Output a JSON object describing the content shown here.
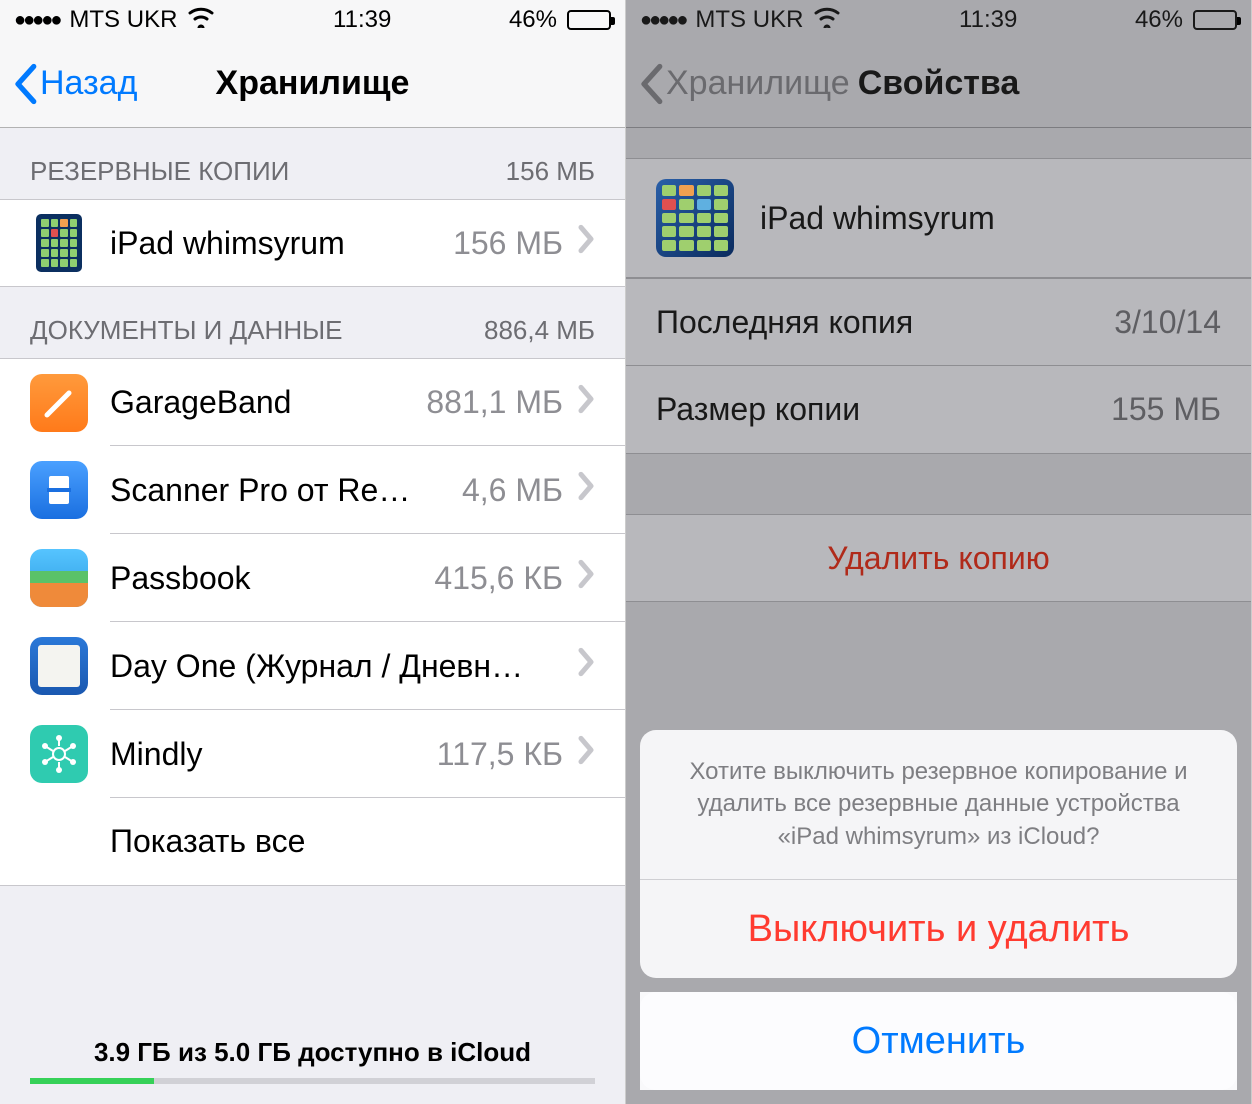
{
  "status": {
    "carrier": "MTS UKR",
    "time": "11:39",
    "battery_pct": "46%"
  },
  "left": {
    "back_label": "Назад",
    "title": "Хранилище",
    "section_backups": {
      "header": "РЕЗЕРВНЫЕ КОПИИ",
      "total": "156 МБ"
    },
    "backup_device": {
      "name": "iPad whimsyrum",
      "size": "156 МБ"
    },
    "section_docs": {
      "header": "ДОКУМЕНТЫ И ДАННЫЕ",
      "total": "886,4 МБ"
    },
    "apps": [
      {
        "name": "GarageBand",
        "size": "881,1 МБ"
      },
      {
        "name": "Scanner Pro от Re…",
        "size": "4,6 МБ"
      },
      {
        "name": "Passbook",
        "size": "415,6 КБ"
      },
      {
        "name": "Day One (Журнал / Дневн…",
        "size": ""
      },
      {
        "name": "Mindly",
        "size": "117,5 КБ"
      }
    ],
    "show_all": "Показать все",
    "footer": "3.9 ГБ из 5.0 ГБ доступно в iCloud"
  },
  "right": {
    "back_label": "Хранилище",
    "title": "Свойства",
    "device_name": "iPad whimsyrum",
    "last_backup_label": "Последняя копия",
    "last_backup_value": "3/10/14",
    "size_label": "Размер копии",
    "size_value": "155 МБ",
    "delete_label": "Удалить копию",
    "sheet": {
      "message": "Хотите выключить резервное копирование и удалить все резервные данные устройства «iPad whimsyrum» из iCloud?",
      "confirm": "Выключить и удалить",
      "cancel": "Отменить"
    }
  }
}
